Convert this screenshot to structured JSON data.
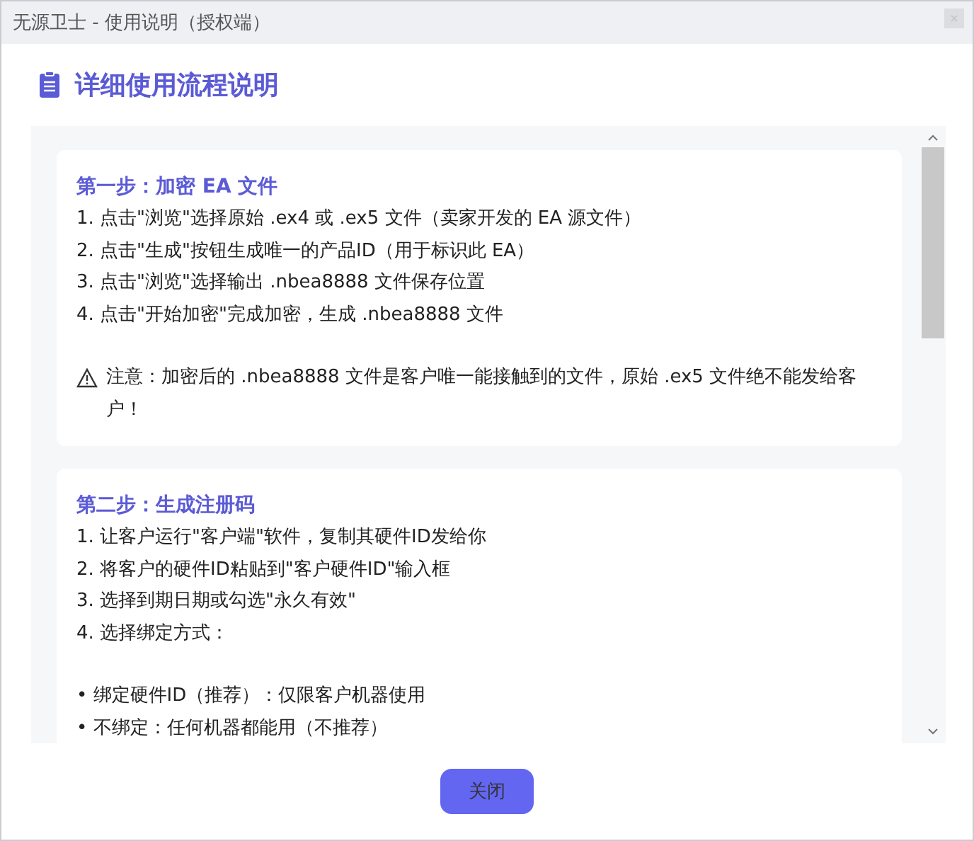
{
  "window": {
    "title": "无源卫士 - 使用说明（授权端）"
  },
  "heading": "详细使用流程说明",
  "steps": [
    {
      "title": "第一步：加密 EA 文件",
      "lines": [
        {
          "kind": "item",
          "text": "1. 点击\"浏览\"选择原始 .ex4 或 .ex5 文件（卖家开发的 EA 源文件）"
        },
        {
          "kind": "item",
          "text": "2. 点击\"生成\"按钮生成唯一的产品ID（用于标识此 EA）"
        },
        {
          "kind": "item",
          "text": "3. 点击\"浏览\"选择输出 .nbea8888 文件保存位置"
        },
        {
          "kind": "item",
          "text": "4. 点击\"开始加密\"完成加密，生成 .nbea8888 文件"
        },
        {
          "kind": "warning",
          "text": "注意：加密后的 .nbea8888 文件是客户唯一能接触到的文件，原始 .ex5 文件绝不能发给客户！"
        }
      ]
    },
    {
      "title": "第二步：生成注册码",
      "lines": [
        {
          "kind": "item",
          "text": "1. 让客户运行\"客户端\"软件，复制其硬件ID发给你"
        },
        {
          "kind": "item",
          "text": "2. 将客户的硬件ID粘贴到\"客户硬件ID\"输入框"
        },
        {
          "kind": "item",
          "text": "3. 选择到期日期或勾选\"永久有效\""
        },
        {
          "kind": "item",
          "text": "4. 选择绑定方式："
        },
        {
          "kind": "bullet",
          "text": "• 绑定硬件ID（推荐）：仅限客户机器使用"
        },
        {
          "kind": "bullet",
          "text": "• 不绑定：任何机器都能用（不推荐）"
        }
      ]
    }
  ],
  "button": "关闭"
}
